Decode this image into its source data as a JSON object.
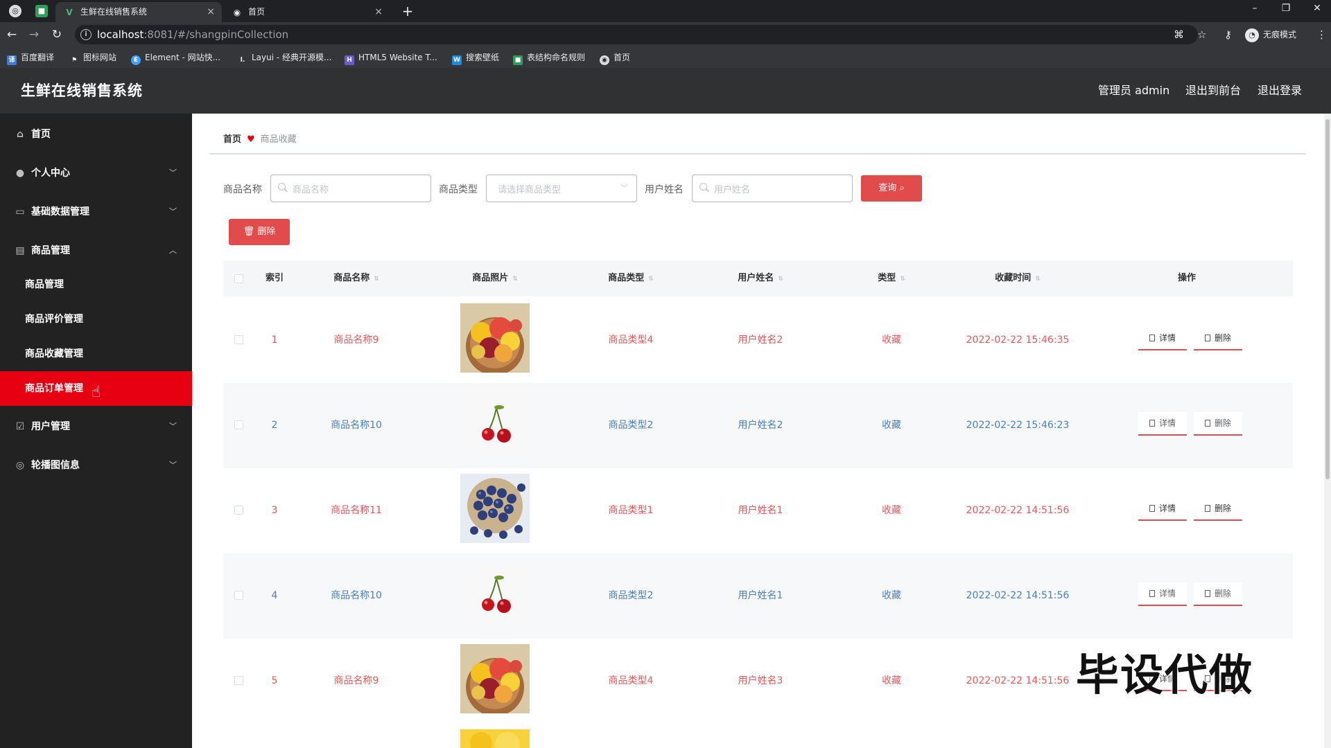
{
  "browser": {
    "tabs": [
      {
        "title": "生鲜在线销售系统",
        "active": true
      },
      {
        "title": "首页",
        "active": false
      }
    ],
    "close_glyph": "×",
    "new_tab_glyph": "+",
    "url_host": "localhost",
    "url_path": ":8081/#/shangpinCollection",
    "incognito_label": "无痕模式",
    "bookmarks": [
      "百度翻译",
      "图标网站",
      "Element - 网站快...",
      "Layui - 经典开源模...",
      "HTML5 Website T...",
      "搜索壁纸",
      "表结构命名规则",
      "首页"
    ]
  },
  "header": {
    "title": "生鲜在线销售系统",
    "admin": "管理员 admin",
    "to_front": "退出到前台",
    "logout": "退出登录"
  },
  "sidebar": {
    "items": [
      {
        "label": "首页",
        "icon": "home-icon"
      },
      {
        "label": "个人中心",
        "icon": "user-icon"
      },
      {
        "label": "基础数据管理",
        "icon": "data-icon"
      },
      {
        "label": "商品管理",
        "icon": "goods-icon"
      }
    ],
    "sub_items": [
      "商品管理",
      "商品评价管理",
      "商品收藏管理",
      "商品订单管理"
    ],
    "active_sub": "商品订单管理",
    "tail_items": [
      {
        "label": "用户管理",
        "icon": "users-icon"
      },
      {
        "label": "轮播图信息",
        "icon": "carousel-icon"
      }
    ]
  },
  "breadcrumb": {
    "home": "首页",
    "current": "商品收藏"
  },
  "search": {
    "name_label": "商品名称",
    "name_placeholder": "商品名称",
    "type_label": "商品类型",
    "type_placeholder": "请选择商品类型",
    "user_label": "用户姓名",
    "user_placeholder": "用户姓名",
    "query_button": "查询",
    "delete_button": "删除"
  },
  "table": {
    "columns": [
      "索引",
      "商品名称",
      "商品照片",
      "商品类型",
      "用户姓名",
      "类型",
      "收藏时间",
      "操作"
    ],
    "rows": [
      {
        "index": "1",
        "name": "商品名称9",
        "photo": "fruit",
        "type": "商品类型4",
        "user": "用户姓名2",
        "kind": "收藏",
        "time": "2022-02-22 15:46:35"
      },
      {
        "index": "2",
        "name": "商品名称10",
        "photo": "cherry",
        "type": "商品类型2",
        "user": "用户姓名2",
        "kind": "收藏",
        "time": "2022-02-22 15:46:23"
      },
      {
        "index": "3",
        "name": "商品名称11",
        "photo": "blueberry",
        "type": "商品类型1",
        "user": "用户姓名1",
        "kind": "收藏",
        "time": "2022-02-22 14:51:56"
      },
      {
        "index": "4",
        "name": "商品名称10",
        "photo": "cherry",
        "type": "商品类型2",
        "user": "用户姓名1",
        "kind": "收藏",
        "time": "2022-02-22 14:51:56"
      },
      {
        "index": "5",
        "name": "商品名称9",
        "photo": "fruit",
        "type": "商品类型4",
        "user": "用户姓名3",
        "kind": "收藏",
        "time": "2022-02-22 14:51:56"
      }
    ],
    "detail_button": "详情",
    "delete_button": "删除"
  },
  "watermark": "毕设代做",
  "colors": {
    "accent": "#e24b4b",
    "sidebar_active": "#e60012",
    "header_bg": "#303133",
    "sidebar_bg": "#222222"
  }
}
